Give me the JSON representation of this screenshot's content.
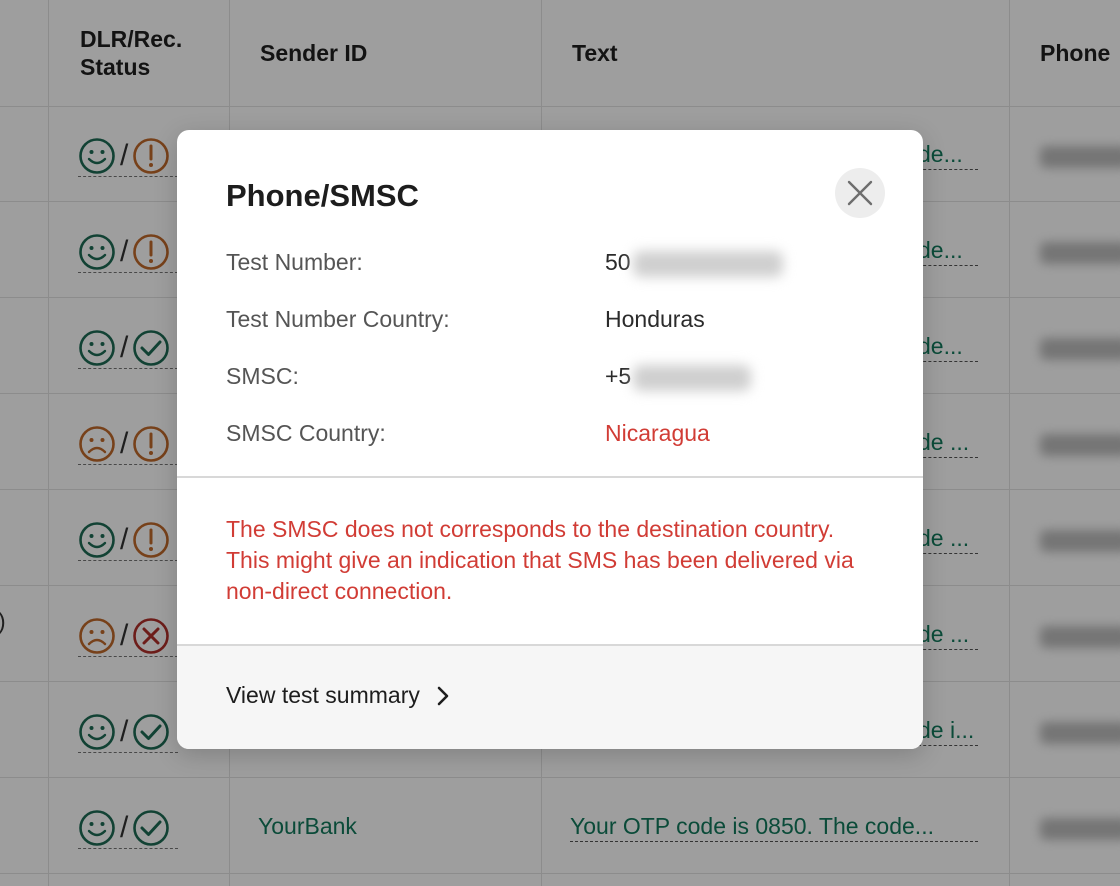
{
  "table": {
    "headers": [
      "DLR/Rec.\nStatus",
      "Sender ID",
      "Text",
      "Phone"
    ],
    "header_dlr_line1": "DLR/Rec.",
    "header_dlr_line2": "Status",
    "header_sender": "Sender ID",
    "header_text": "Text",
    "header_phone": "Phone",
    "rows": [
      {
        "dlr": "smile-icon",
        "rec": "exclaim-icon",
        "text_tail": "de..."
      },
      {
        "dlr": "smile-icon",
        "rec": "exclaim-icon",
        "text_tail": "de..."
      },
      {
        "dlr": "smile-icon",
        "rec": "check-icon",
        "text_tail": "de..."
      },
      {
        "dlr": "frown-icon",
        "rec": "exclaim-icon",
        "text_tail": "de ..."
      },
      {
        "dlr": "smile-icon",
        "rec": "exclaim-icon",
        "text_tail": "de ..."
      },
      {
        "dlr": "frown-icon",
        "rec": "x-icon",
        "text_tail": "de ...",
        "left_fragment": ")"
      },
      {
        "dlr": "smile-icon",
        "rec": "check-icon",
        "text_tail": "de i..."
      },
      {
        "dlr": "smile-icon",
        "rec": "check-icon",
        "sender": "YourBank",
        "text": "Your OTP code is 0850. The code..."
      }
    ],
    "row7_sender": "YourBank",
    "row7_text": "Your OTP code is 0850. The code...",
    "row5_left_fragment": ")"
  },
  "colors": {
    "smile": "#1d6b55",
    "frown": "#c0692a",
    "exclaim": "#c0692a",
    "check": "#1d6b55",
    "x": "#b0302a",
    "link_green": "#127a5c",
    "warning_red": "#d13c35"
  },
  "modal": {
    "title": "Phone/SMSC",
    "close_icon": "close-icon",
    "fields": {
      "test_number_label": "Test Number:",
      "test_number_value_visible": "50",
      "test_number_country_label": "Test Number Country:",
      "test_number_country_value": "Honduras",
      "smsc_label": "SMSC:",
      "smsc_value_visible": "+5",
      "smsc_country_label": "SMSC Country:",
      "smsc_country_value": "Nicaragua"
    },
    "warning": "The SMSC does not corresponds to the destination country. This might give an indication that SMS has been delivered via non-direct connection.",
    "footer_link": "View test summary",
    "footer_icon": "chevron-right-icon"
  }
}
